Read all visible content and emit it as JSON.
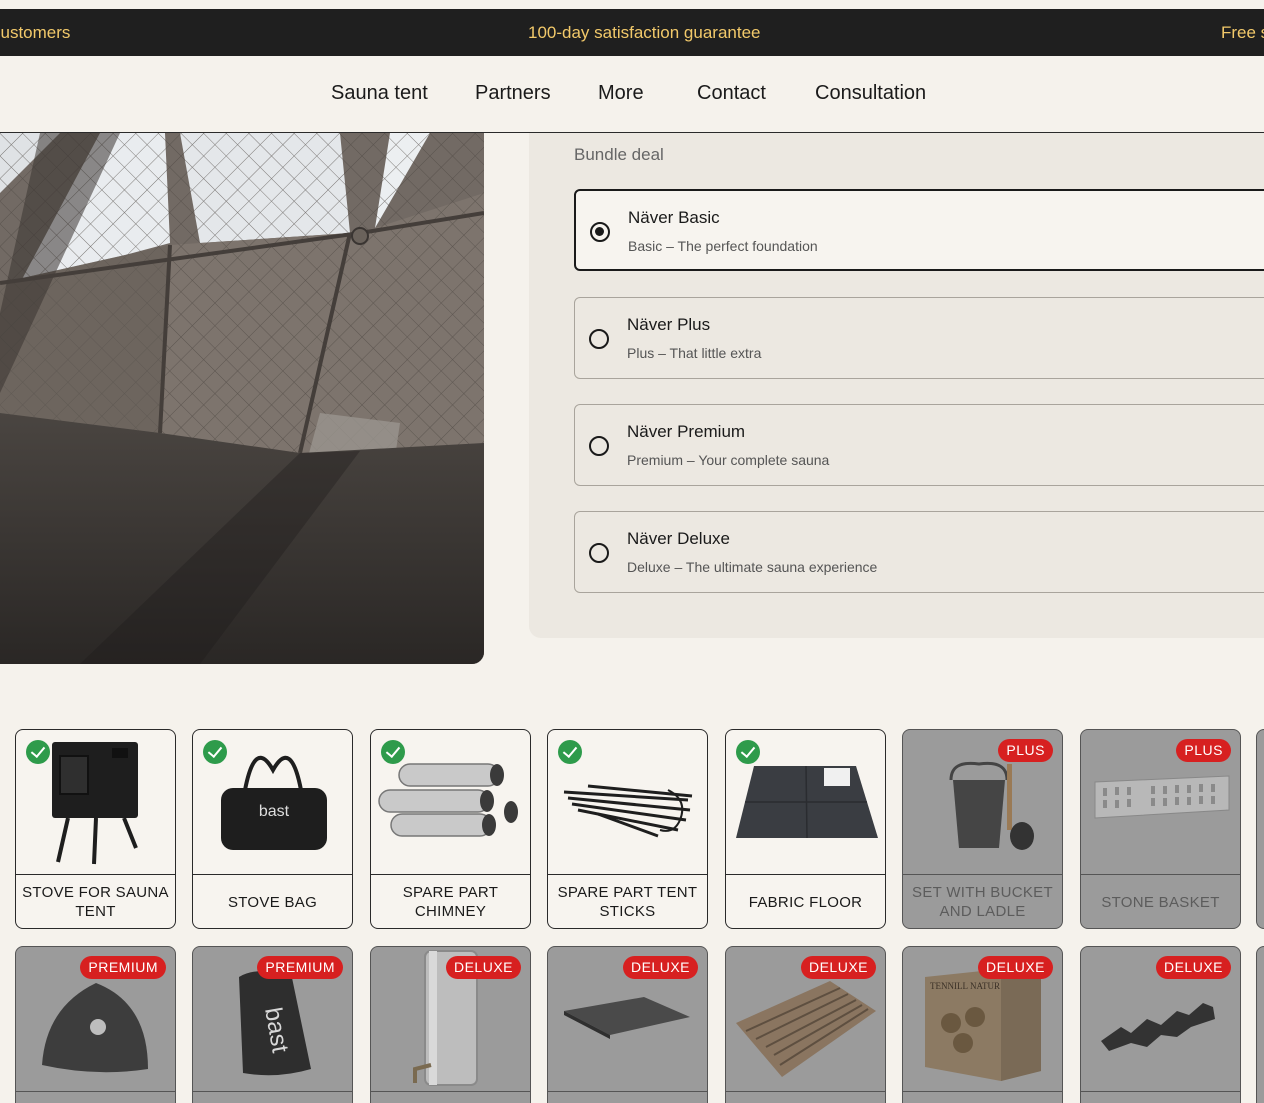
{
  "announcement": {
    "left": "customers",
    "center": "100-day satisfaction guarantee",
    "right": "Free s"
  },
  "nav": [
    "Sauna tent",
    "Partners",
    "More",
    "Contact",
    "Consultation"
  ],
  "bundle": {
    "label": "Bundle deal",
    "selected_index": 0,
    "options": [
      {
        "title": "Näver Basic",
        "subtitle": "Basic – The perfect foundation"
      },
      {
        "title": "Näver Plus",
        "subtitle": "Plus – That little extra"
      },
      {
        "title": "Näver Premium",
        "subtitle": "Premium – Your complete sauna"
      },
      {
        "title": "Näver Deluxe",
        "subtitle": "Deluxe – The ultimate sauna experience"
      }
    ]
  },
  "products_row1": [
    {
      "name": "STOVE FOR SAUNA TENT",
      "included": true,
      "badge": "",
      "icon": "stove-icon"
    },
    {
      "name": "STOVE BAG",
      "included": true,
      "badge": "",
      "icon": "bag-icon",
      "logo_text": "bast"
    },
    {
      "name": "SPARE PART CHIMNEY",
      "included": true,
      "badge": "",
      "icon": "chimney-icon"
    },
    {
      "name": "SPARE PART TENT STICKS",
      "included": true,
      "badge": "",
      "icon": "sticks-icon"
    },
    {
      "name": "FABRIC FLOOR",
      "included": true,
      "badge": "",
      "icon": "floor-icon"
    },
    {
      "name": "SET WITH BUCKET AND LADLE",
      "included": false,
      "badge": "PLUS",
      "icon": "bucket-icon"
    },
    {
      "name": "STONE BASKET",
      "included": false,
      "badge": "PLUS",
      "icon": "basket-icon"
    }
  ],
  "products_row2": [
    {
      "badge": "PREMIUM",
      "icon": "sauna-hat-icon"
    },
    {
      "badge": "PREMIUM",
      "icon": "storage-bag-icon",
      "logo_text": "bast"
    },
    {
      "badge": "DELUXE",
      "icon": "water-heater-icon"
    },
    {
      "badge": "DELUXE",
      "icon": "bench-board-icon"
    },
    {
      "badge": "DELUXE",
      "icon": "wood-mat-icon"
    },
    {
      "badge": "DELUXE",
      "icon": "firewood-box-icon",
      "logo_text": "TENNILL NATUR"
    },
    {
      "badge": "DELUXE",
      "icon": "seat-pad-icon"
    }
  ]
}
